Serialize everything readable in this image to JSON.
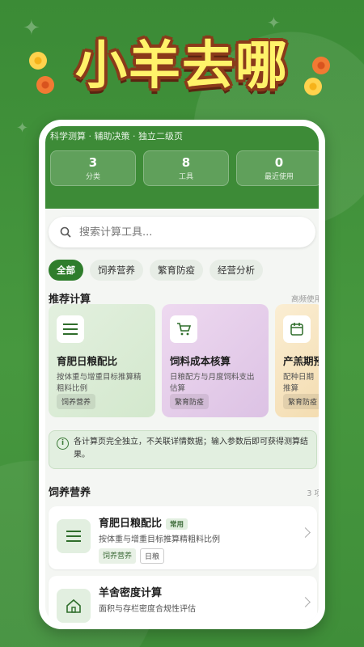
{
  "banner": {
    "title": "小羊去哪"
  },
  "header": {
    "subtitle": "科学测算 · 辅助决策 · 独立二级页",
    "stats": [
      {
        "value": "3",
        "label": "分类"
      },
      {
        "value": "8",
        "label": "工具"
      },
      {
        "value": "0",
        "label": "最近使用"
      }
    ]
  },
  "search": {
    "placeholder": "搜索计算工具..."
  },
  "filters": [
    "全部",
    "饲养营养",
    "繁育防疫",
    "经营分析"
  ],
  "recommended": {
    "title": "推荐计算",
    "hint": "高频使用",
    "cards": [
      {
        "title": "育肥日粮配比",
        "desc": "按体重与增重目标推算精粗料比例",
        "tag": "饲养营养",
        "icon": "list-icon"
      },
      {
        "title": "饲料成本核算",
        "desc": "日粮配方与月度饲料支出估算",
        "tag": "繁育防疫",
        "icon": "cart-icon"
      },
      {
        "title": "产羔期预",
        "desc": "配种日期推算",
        "tag": "繁育防疫",
        "icon": "calendar-icon"
      }
    ]
  },
  "notice": {
    "text": "各计算页完全独立，不关联详情数据；输入参数后即可获得测算结果。"
  },
  "section": {
    "title": "饲养营养",
    "count": "3 项",
    "items": [
      {
        "title": "育肥日粮配比",
        "badge": "常用",
        "desc": "按体重与增重目标推算精粗料比例",
        "tags": [
          "饲养营养",
          "日粮"
        ],
        "icon": "list-icon"
      },
      {
        "title": "羊舍密度计算",
        "desc": "面积与存栏密度合规性评估",
        "icon": "house-icon"
      }
    ]
  },
  "colors": {
    "primary": "#3d8b37",
    "banner_text": "#fff36a",
    "banner_outline": "#8a3a1a"
  }
}
